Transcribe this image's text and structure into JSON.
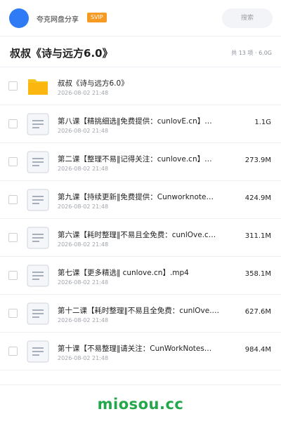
{
  "header": {
    "brand": "夸克网盘分享",
    "badge": "SVIP",
    "search_placeholder": "搜索"
  },
  "folder": {
    "title": "叔叔《诗与远方6.0》",
    "summary": "共 13 项 · 6.0G"
  },
  "files": [
    {
      "type": "folder",
      "name": "叔叔《诗与远方6.0》",
      "date": "2026-08-02 21:48",
      "size": ""
    },
    {
      "type": "file",
      "name": "第八课【精挑细选‖免费提供：cunlovE.cn】…",
      "date": "2026-08-02 21:48",
      "size": "1.1G"
    },
    {
      "type": "file",
      "name": "第二课【整理不易‖记得关注：cunlove.cn】…",
      "date": "2026-08-02 21:48",
      "size": "273.9M"
    },
    {
      "type": "file",
      "name": "第九课【持续更新‖免费提供：Cunworknote…",
      "date": "2026-08-02 21:48",
      "size": "424.9M"
    },
    {
      "type": "file",
      "name": "第六课【耗时整理‖不易且全免费：cunlOve.c…",
      "date": "2026-08-02 21:48",
      "size": "311.1M"
    },
    {
      "type": "file",
      "name": "第七课【更多精选‖ cunlove.cn】.mp4",
      "date": "2026-08-02 21:48",
      "size": "358.1M"
    },
    {
      "type": "file",
      "name": "第十二课【耗时整理‖不易且全免费：cunlOve.…",
      "date": "2026-08-02 21:48",
      "size": "627.6M"
    },
    {
      "type": "file",
      "name": "第十课【不易整理‖请关注：CunWorkNotes…",
      "date": "2026-08-02 21:48",
      "size": "984.4M"
    }
  ],
  "footer": {
    "watermark": "miosou.cc"
  },
  "colors": {
    "accent": "#2f7bf5",
    "badge": "#f59a23",
    "folder": "#f8c21e",
    "watermark": "#22a74a"
  }
}
